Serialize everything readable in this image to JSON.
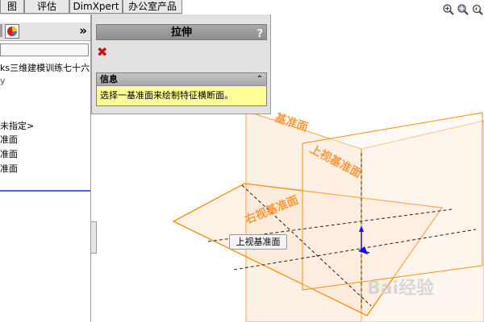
{
  "tabs": [
    {
      "label": "图"
    },
    {
      "label": "评估"
    },
    {
      "label": "DimXpert"
    },
    {
      "label": "办公室产品"
    }
  ],
  "feature_tree": {
    "expand_label": "»",
    "part_name": "ks三维建模训练七十六",
    "line_y": "y",
    "items": [
      {
        "label": "未指定>"
      },
      {
        "label": "准面"
      },
      {
        "label": "准面"
      },
      {
        "label": "准面"
      }
    ]
  },
  "property_manager": {
    "title": "拉伸",
    "help_label": "?",
    "cancel_label": "✖",
    "info": {
      "title": "信息",
      "collapse_label": "⌃",
      "message": "选择一基准面来绘制特征横断面。"
    }
  },
  "graphics": {
    "plane_front_label": "基准面",
    "plane_top_label": "上视基准面",
    "plane_right_label": "右视基准面",
    "tooltip": "上视基准面",
    "accent_color": "#ff8c00"
  },
  "view_icons": [
    "zoom-to-fit-icon",
    "zoom-area-icon",
    "previous-view-icon"
  ],
  "watermark": "Bai经验"
}
